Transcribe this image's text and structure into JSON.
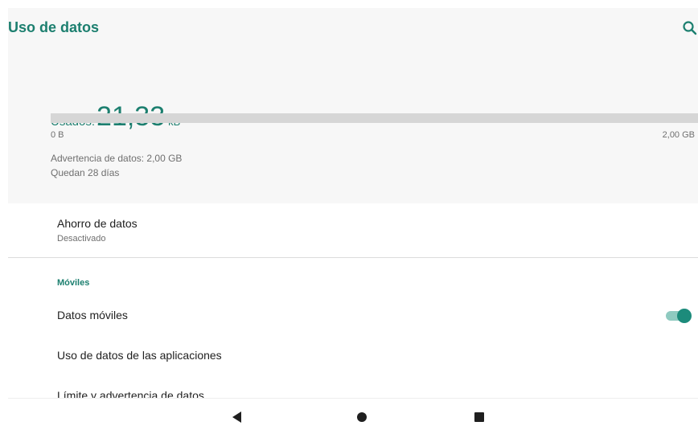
{
  "app_bar": {
    "title": "Uso de datos",
    "search_icon": "search-icon"
  },
  "usage": {
    "used_label": "Usados:",
    "used_value": "21,33",
    "used_unit": "kB",
    "progress_fraction": 0.0,
    "bar_min": "0 B",
    "bar_max": "2,00 GB",
    "warning": "Advertencia de datos: 2,00 GB",
    "days_left": "Quedan 28 días"
  },
  "data_saver": {
    "title": "Ahorro de datos",
    "summary": "Desactivado"
  },
  "mobile_section": {
    "header": "Móviles",
    "items": [
      {
        "label": "Datos móviles",
        "toggle_on": true
      },
      {
        "label": "Uso de datos de las aplicaciones"
      },
      {
        "label": "Límite y advertencia de datos"
      }
    ]
  },
  "nav_bar": {
    "back_icon": "back-triangle-icon",
    "home_icon": "home-circle-icon",
    "recents_icon": "recents-square-icon"
  },
  "colors": {
    "accent": "#1c7f6f",
    "toggle_track": "#8fcac0",
    "panel_bg": "#f7f7f7"
  }
}
